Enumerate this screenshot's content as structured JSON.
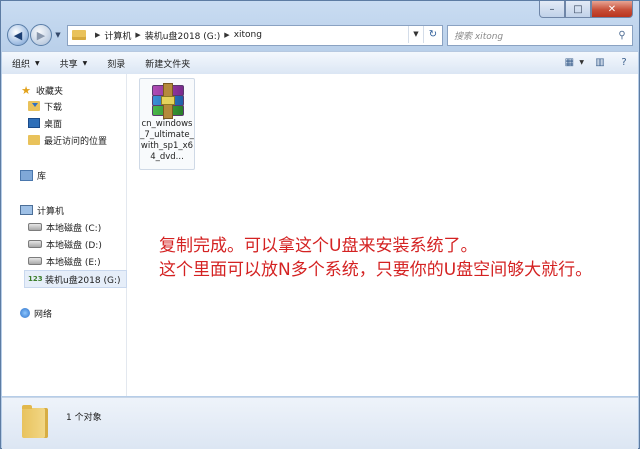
{
  "window": {
    "controls": {
      "minimize": "–",
      "maximize": "□",
      "close": "✕"
    }
  },
  "address": {
    "back_icon": "back-arrow-icon",
    "forward_icon": "forward-arrow-icon",
    "crumbs": [
      "计算机",
      "装机u盘2018 (G:)",
      "xitong"
    ]
  },
  "search": {
    "placeholder": "搜索 xitong"
  },
  "toolbar": {
    "organize": "组织",
    "share": "共享",
    "burn": "刻录",
    "new_folder": "新建文件夹"
  },
  "nav": {
    "favorites": "收藏夹",
    "downloads": "下载",
    "desktop": "桌面",
    "recent": "最近访问的位置",
    "libraries": "库",
    "computer": "计算机",
    "drive_c": "本地磁盘 (C:)",
    "drive_d": "本地磁盘 (D:)",
    "drive_e": "本地磁盘 (E:)",
    "drive_g": "装机u盘2018 (G:)",
    "network": "网络"
  },
  "file": {
    "name": "cn_windows_7_ultimate_with_sp1_x64_dvd...",
    "icon": "winrar-archive-icon"
  },
  "overlay": {
    "line1": "复制完成。可以拿这个U盘来安装系统了。",
    "line2": "这个里面可以放N多个系统，只要你的U盘空间够大就行。"
  },
  "status": {
    "count": "1 个对象"
  },
  "colors": {
    "overlay_text": "#d42222",
    "selection": "#e6eef9"
  }
}
